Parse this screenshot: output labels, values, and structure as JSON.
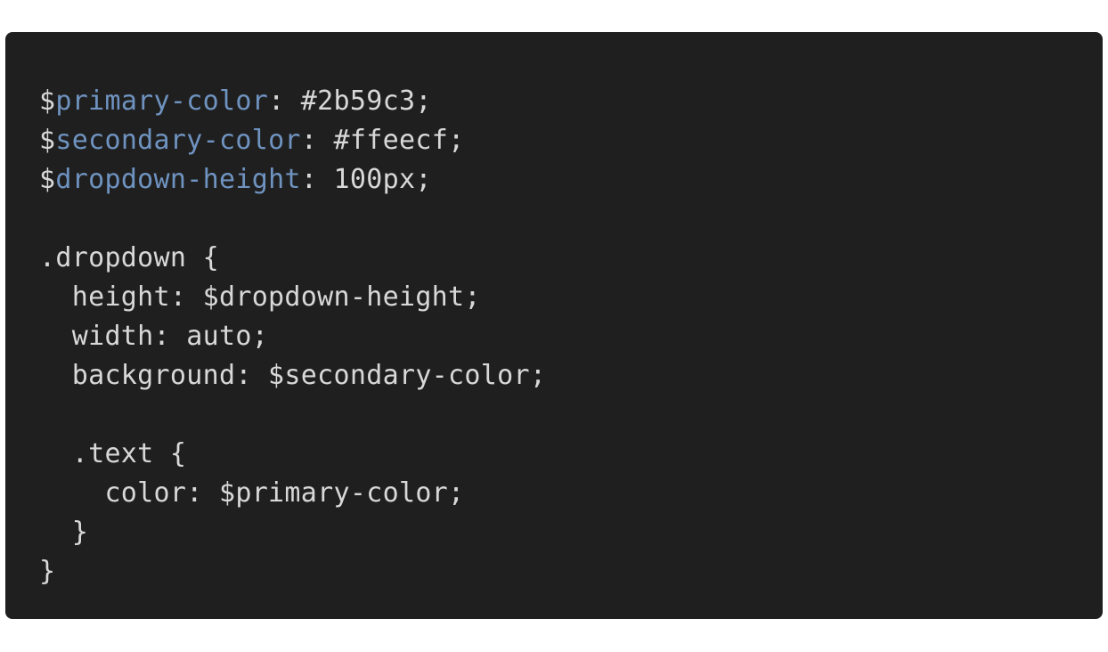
{
  "code": {
    "lines": [
      [
        {
          "t": "$",
          "c": "plain"
        },
        {
          "t": "primary-color",
          "c": "var"
        },
        {
          "t": ": #2b59c3;",
          "c": "plain"
        }
      ],
      [
        {
          "t": "$",
          "c": "plain"
        },
        {
          "t": "secondary-color",
          "c": "var"
        },
        {
          "t": ": #ffeecf;",
          "c": "plain"
        }
      ],
      [
        {
          "t": "$",
          "c": "plain"
        },
        {
          "t": "dropdown-height",
          "c": "var"
        },
        {
          "t": ": 100px;",
          "c": "plain"
        }
      ],
      [],
      [
        {
          "t": ".dropdown {",
          "c": "plain"
        }
      ],
      [
        {
          "t": "  height: $dropdown-height;",
          "c": "plain"
        }
      ],
      [
        {
          "t": "  width: auto;",
          "c": "plain"
        }
      ],
      [
        {
          "t": "  background: $secondary-color;",
          "c": "plain"
        }
      ],
      [],
      [
        {
          "t": "  .text {",
          "c": "plain"
        }
      ],
      [
        {
          "t": "    color: $primary-color;",
          "c": "plain"
        }
      ],
      [
        {
          "t": "  }",
          "c": "plain"
        }
      ],
      [
        {
          "t": "}",
          "c": "plain"
        }
      ]
    ]
  },
  "colors": {
    "background": "#1f1f1f",
    "variable": "#6f93c0",
    "text": "#d8d8d8"
  }
}
